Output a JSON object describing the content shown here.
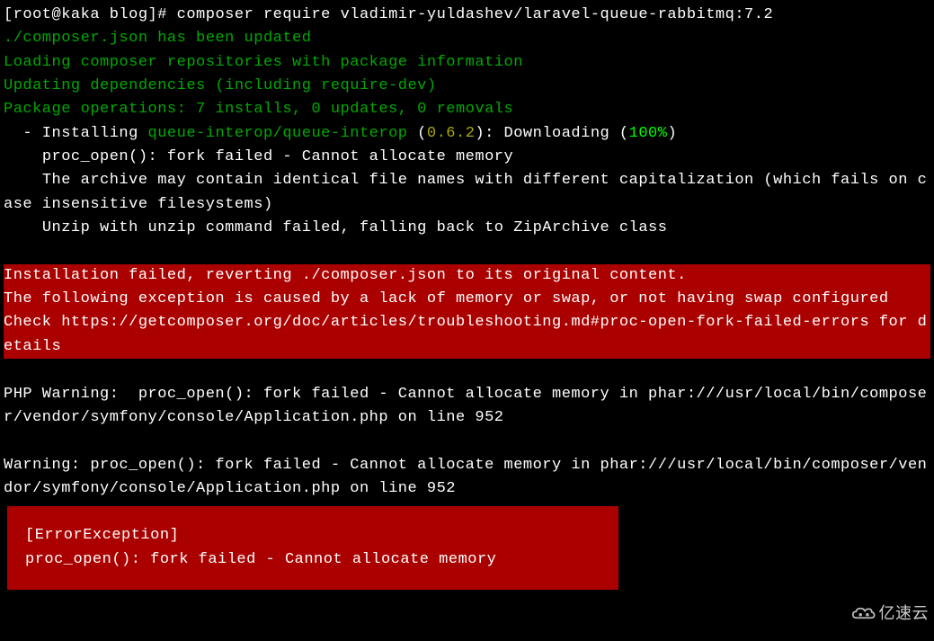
{
  "prompt": {
    "user_host": "[root@kaka blog]#",
    "command": "composer require vladimir-yuldashev/laravel-queue-rabbitmq:7.2"
  },
  "composer_output": {
    "updated": "./composer.json has been updated",
    "loading": "Loading composer repositories with package information",
    "updating": "Updating dependencies (including require-dev)",
    "operations": "Package operations: 7 installs, 0 updates, 0 removals",
    "install_prefix": "  - Installing ",
    "package_name": "queue-interop/queue-interop",
    "version_open": " (",
    "version": "0.6.2",
    "version_close": "): Downloading (",
    "percent": "100%",
    "percent_close": ")",
    "proc_open_err": "    proc_open(): fork failed - Cannot allocate memory",
    "archive_warning": "    The archive may contain identical file names with different capitalization (which fails on case insensitive filesystems)",
    "unzip_fallback": "    Unzip with unzip command failed, falling back to ZipArchive class"
  },
  "error_block": {
    "line1": "Installation failed, reverting ./composer.json to its original content.",
    "line2": "The following exception is caused by a lack of memory or swap, or not having swap configured",
    "line3": "Check https://getcomposer.org/doc/articles/troubleshooting.md#proc-open-fork-failed-errors for details"
  },
  "php_warning": {
    "line1": "PHP Warning:  proc_open(): fork failed - Cannot allocate memory in phar:///usr/local/bin/composer/vendor/symfony/console/Application.php on line 952",
    "line2": "Warning: proc_open(): fork failed - Cannot allocate memory in phar:///usr/local/bin/composer/vendor/symfony/console/Application.php on line 952"
  },
  "exception_box": {
    "title": "[ErrorException]",
    "message": "proc_open(): fork failed - Cannot allocate memory"
  },
  "watermark": {
    "text": "亿速云"
  }
}
